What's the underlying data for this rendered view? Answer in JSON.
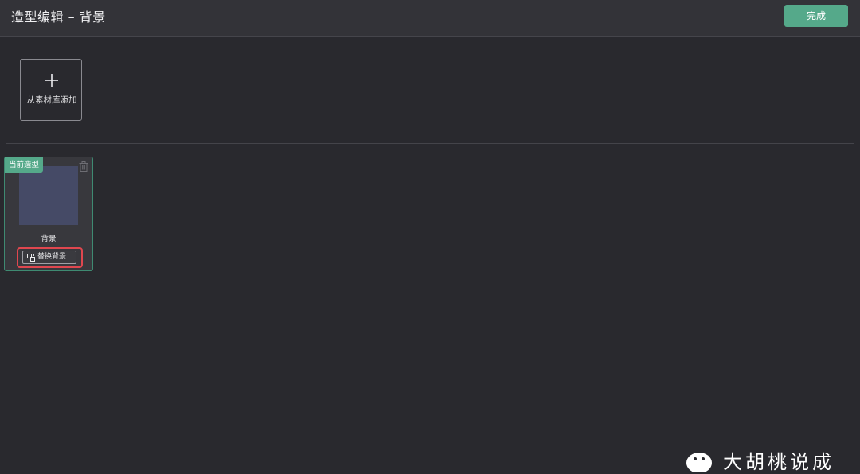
{
  "header": {
    "title": "造型编辑 – 背景",
    "done_label": "完成"
  },
  "library": {
    "add_label": "从素材库添加",
    "add_icon": "plus-icon"
  },
  "costumes": [
    {
      "badge": "当前造型",
      "name": "背景",
      "replace_label": "替换背景",
      "thumbnail_color": "#454a66",
      "delete_icon": "trash-icon",
      "replace_icon": "replace-image-icon"
    }
  ],
  "watermark": {
    "icon": "wechat-icon",
    "text": "大胡桃说成"
  },
  "colors": {
    "accent": "#55a98a",
    "background": "#29292e",
    "highlight": "#e0474f"
  }
}
